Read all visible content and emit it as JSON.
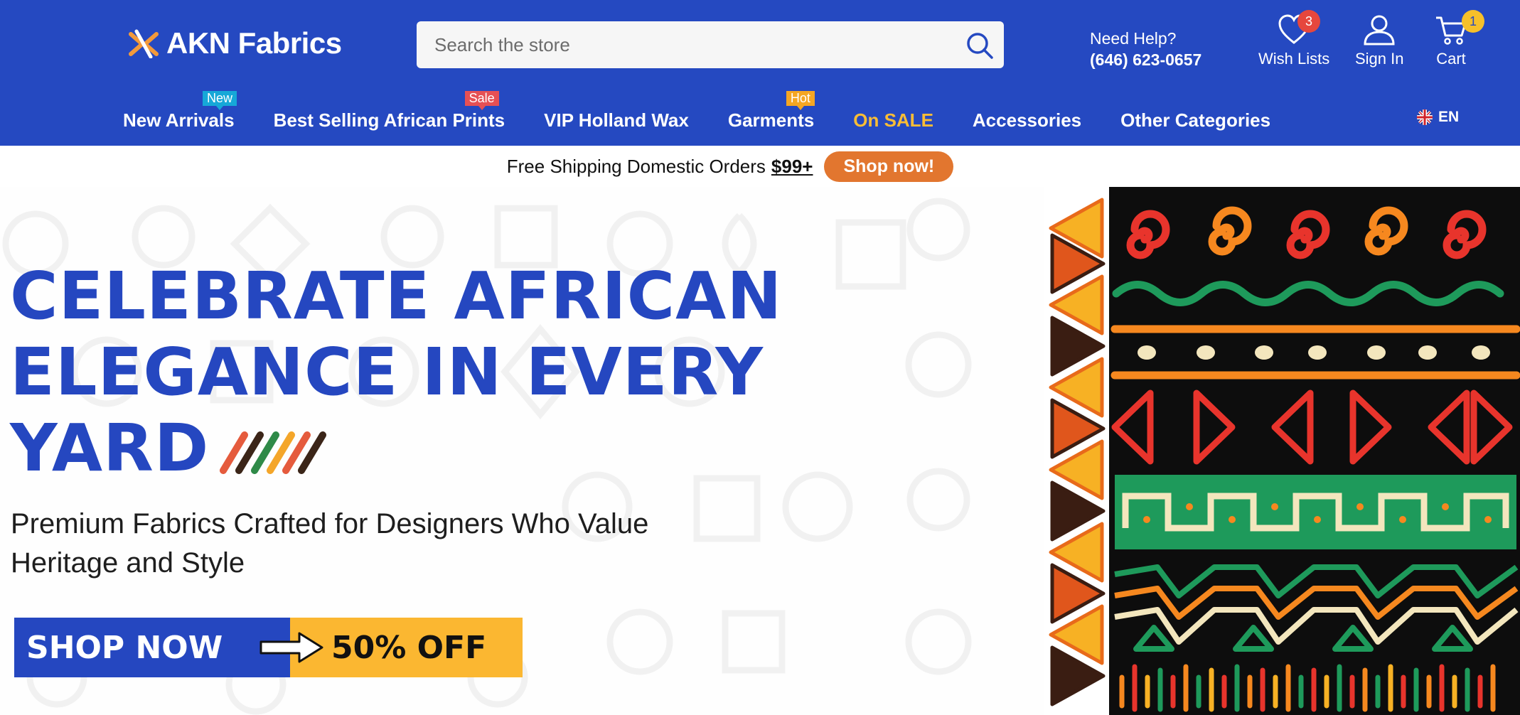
{
  "header": {
    "logo_text": "AKN Fabrics",
    "search_placeholder": "Search the store",
    "help_label": "Need Help?",
    "help_phone": "(646) 623-0657",
    "wishlist_label": "Wish Lists",
    "wishlist_count": "3",
    "signin_label": "Sign In",
    "cart_label": "Cart",
    "cart_count": "1",
    "language": "EN"
  },
  "nav": {
    "items": [
      {
        "label": "New Arrivals",
        "tag": "New"
      },
      {
        "label": "Best Selling African Prints",
        "tag": "Sale"
      },
      {
        "label": "VIP Holland Wax"
      },
      {
        "label": "Garments",
        "tag": "Hot"
      },
      {
        "label": "On SALE"
      },
      {
        "label": "Accessories"
      },
      {
        "label": "Other Categories"
      }
    ]
  },
  "promo_bar": {
    "text": "Free Shipping Domestic Orders",
    "amount": "$99+",
    "button": "Shop now!"
  },
  "hero": {
    "headline_line1": "CELEBRATE AFRICAN",
    "headline_line2": "ELEGANCE IN EVERY",
    "headline_line3": "YARD",
    "subheadline": "Premium Fabrics Crafted for Designers Who Value Heritage and Style",
    "cta_left": "SHOP NOW",
    "cta_right": "50% OFF"
  },
  "colors": {
    "brand_blue": "#2549c1",
    "headline_blue": "#2547c0",
    "sale_gold": "#f9bd36",
    "promo_orange": "#e2762f",
    "cta_yellow": "#fbb731",
    "badge_red": "#e6473d",
    "badge_yellow": "#f6c02a"
  },
  "icons": [
    "logo-mark-icon",
    "search-icon",
    "heart-icon",
    "user-icon",
    "cart-icon",
    "uk-flag-icon",
    "arrow-right-icon"
  ]
}
